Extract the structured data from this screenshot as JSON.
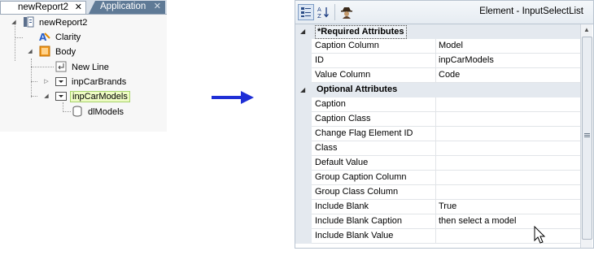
{
  "left": {
    "tabs": [
      {
        "label": "newReport2",
        "close": "✕"
      },
      {
        "label": "Application",
        "close": "✕"
      }
    ],
    "tree": [
      {
        "label": "newReport2",
        "icon": "report-icon"
      },
      {
        "label": "Clarity",
        "icon": "theme-icon"
      },
      {
        "label": "Body",
        "icon": "body-icon"
      },
      {
        "label": "New Line",
        "icon": "newline-icon"
      },
      {
        "label": "inpCarBrands",
        "icon": "select-icon"
      },
      {
        "label": "inpCarModels",
        "icon": "select-icon"
      },
      {
        "label": "dlModels",
        "icon": "datalayer-icon"
      }
    ]
  },
  "right": {
    "toolbar": {
      "categorized_icon": "categorized-icon",
      "alphabetical_icon": "alphabetical-sort-icon",
      "spy_icon": "spy-icon",
      "element_title": "Element - InputSelectList"
    },
    "categories": [
      {
        "name": "*Required Attributes",
        "rows": [
          {
            "name": "Caption Column",
            "value": "Model"
          },
          {
            "name": "ID",
            "value": "inpCarModels"
          },
          {
            "name": "Value Column",
            "value": "Code"
          }
        ]
      },
      {
        "name": "Optional Attributes",
        "rows": [
          {
            "name": "Caption",
            "value": ""
          },
          {
            "name": "Caption Class",
            "value": ""
          },
          {
            "name": "Change Flag Element ID",
            "value": ""
          },
          {
            "name": "Class",
            "value": ""
          },
          {
            "name": "Default Value",
            "value": ""
          },
          {
            "name": "Group Caption Column",
            "value": ""
          },
          {
            "name": "Group Class Column",
            "value": ""
          },
          {
            "name": "Include Blank",
            "value": "True"
          },
          {
            "name": "Include Blank Caption",
            "value": "then select a model"
          },
          {
            "name": "Include Blank Value",
            "value": ""
          }
        ]
      }
    ]
  },
  "colors": {
    "arrow": "#1f2fd6",
    "selection_highlight": "#eefbc4",
    "tab_inactive": "#5f7a96",
    "category_bg": "#e4e9ef"
  }
}
